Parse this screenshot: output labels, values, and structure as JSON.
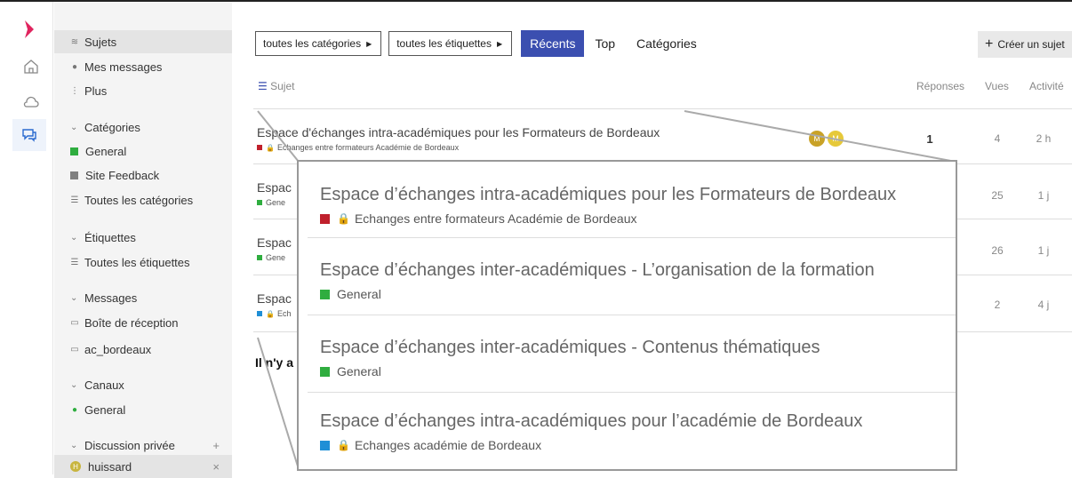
{
  "sidebar": {
    "items": [
      {
        "label": "Sujets"
      },
      {
        "label": "Mes messages"
      },
      {
        "label": "Plus"
      },
      {
        "label": "Catégories"
      },
      {
        "label": "General"
      },
      {
        "label": "Site Feedback"
      },
      {
        "label": "Toutes les catégories"
      },
      {
        "label": "Étiquettes"
      },
      {
        "label": "Toutes les étiquettes"
      },
      {
        "label": "Messages"
      },
      {
        "label": "Boîte de réception"
      },
      {
        "label": "ac_bordeaux"
      },
      {
        "label": "Canaux"
      },
      {
        "label": "General"
      },
      {
        "label": "Discussion privée"
      },
      {
        "label": "huissard"
      }
    ],
    "add_symbol": "+",
    "close_symbol": "×",
    "avatar_letter": "H"
  },
  "toolbar": {
    "categories_drop": "toutes les catégories",
    "tags_drop": "toutes les étiquettes",
    "tab_recent": "Récents",
    "tab_top": "Top",
    "tab_categories": "Catégories",
    "create_label": "Créer un sujet"
  },
  "table": {
    "col_topic": "Sujet",
    "col_replies": "Réponses",
    "col_views": "Vues",
    "col_activity": "Activité",
    "rows": [
      {
        "title": "Espace d'échanges intra-académiques pour les Formateurs de Bordeaux",
        "cat": "Echanges entre formateurs Académie de Bordeaux",
        "replies": "1",
        "views": "4",
        "activity": "2 h"
      },
      {
        "title": "Espac",
        "cat": "Gene",
        "replies": "",
        "views": "25",
        "activity": "1 j"
      },
      {
        "title": "Espac",
        "cat": "Gene",
        "replies": "",
        "views": "26",
        "activity": "1 j"
      },
      {
        "title": "Espac",
        "cat": "Ech",
        "replies": "",
        "views": "2",
        "activity": "4 j"
      }
    ],
    "no_more": "Il n'y a"
  },
  "posters": {
    "first": "M",
    "second": "M"
  },
  "callout": {
    "rows": [
      {
        "title": "Espace d’échanges intra-académiques pour les Formateurs de Bordeaux",
        "cat": "Echanges entre formateurs Académie de Bordeaux"
      },
      {
        "title": "Espace d’échanges inter-académiques - L’organisation de la formation",
        "cat": "General"
      },
      {
        "title": "Espace d’échanges inter-académiques - Contenus thématiques",
        "cat": "General"
      },
      {
        "title": "Espace d’échanges intra-académiques pour l’académie de Bordeaux",
        "cat": "Echanges académie de Bordeaux"
      }
    ]
  },
  "colors": {
    "accent": "#3b4fb0",
    "logo": "#e0245e",
    "cat_red": "#c0202c",
    "cat_green": "#2fad3f",
    "cat_blue": "#1f8fd6",
    "cat_gray": "#808080",
    "avatar_gold": "#c9a227"
  }
}
